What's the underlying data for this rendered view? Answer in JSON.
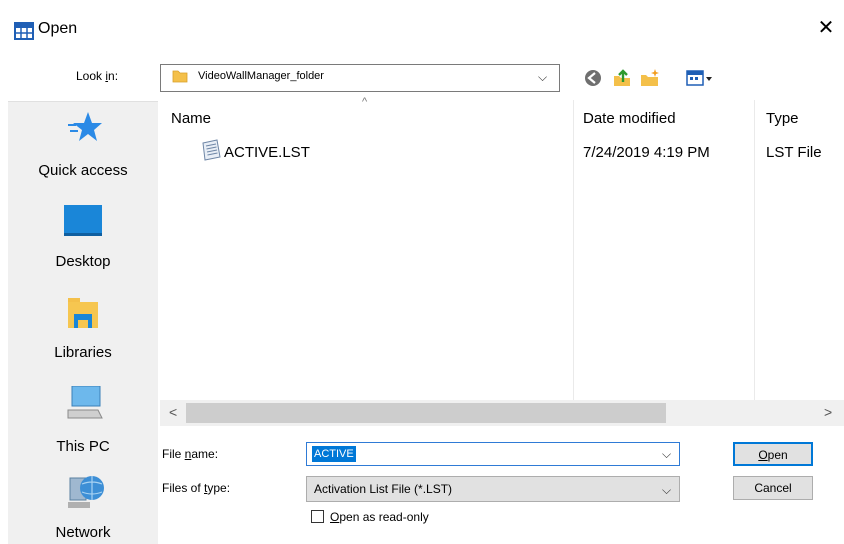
{
  "window": {
    "title": "Open",
    "close_glyph": "✕"
  },
  "look_in": {
    "label_pre": "Look ",
    "label_hot": "i",
    "label_post": "n:",
    "value": "VideoWallManager_folder",
    "arrow": "⌵"
  },
  "toolbar": {
    "icons": [
      "back-icon",
      "up-folder-icon",
      "new-folder-icon",
      "view-menu-icon"
    ]
  },
  "places": [
    {
      "label": "Quick access",
      "icon": "quick-access-star-icon"
    },
    {
      "label": "Desktop",
      "icon": "desktop-icon"
    },
    {
      "label": "Libraries",
      "icon": "libraries-icon"
    },
    {
      "label": "This PC",
      "icon": "this-pc-icon"
    },
    {
      "label": "Network",
      "icon": "network-icon"
    }
  ],
  "columns": {
    "name": "Name",
    "date": "Date modified",
    "type": "Type",
    "sort_glyph": "^"
  },
  "files": [
    {
      "name": "ACTIVE.LST",
      "date": "7/24/2019 4:19 PM",
      "type": "LST File"
    }
  ],
  "scroll": {
    "left": "<",
    "right": ">"
  },
  "file_name": {
    "label_pre": "File ",
    "label_hot": "n",
    "label_post": "ame:",
    "value": "ACTIVE",
    "arrow": "⌵"
  },
  "file_type": {
    "label_pre": "Files of ",
    "label_hot": "t",
    "label_post": "ype:",
    "value": "Activation List File (*.LST)",
    "arrow": "⌵"
  },
  "buttons": {
    "open_hot": "O",
    "open_rest": "pen",
    "cancel": "Cancel"
  },
  "read_only": {
    "label_hot": "O",
    "label_rest": "pen as read-only",
    "checked": false
  },
  "colors": {
    "accent": "#0078d7",
    "places_bg": "#f0f0f0",
    "button_bg": "#e1e1e1"
  }
}
